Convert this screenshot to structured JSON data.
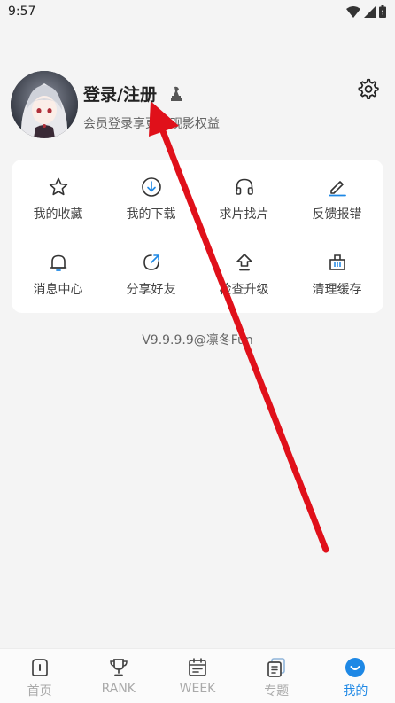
{
  "status": {
    "time": "9:57"
  },
  "profile": {
    "username": "登录/注册",
    "subtitle": "会员登录享更多观影权益"
  },
  "menu": [
    {
      "label": "我的收藏",
      "icon": "star-icon"
    },
    {
      "label": "我的下载",
      "icon": "download-icon"
    },
    {
      "label": "求片找片",
      "icon": "headphones-icon"
    },
    {
      "label": "反馈报错",
      "icon": "edit-icon"
    },
    {
      "label": "消息中心",
      "icon": "bell-icon"
    },
    {
      "label": "分享好友",
      "icon": "share-icon"
    },
    {
      "label": "检查升级",
      "icon": "upgrade-icon"
    },
    {
      "label": "清理缓存",
      "icon": "trash-icon"
    }
  ],
  "version": "V9.9.9.9@凛冬Fun",
  "tabs": [
    {
      "label": "首页",
      "icon": "home-icon"
    },
    {
      "label": "RANK",
      "icon": "trophy-icon"
    },
    {
      "label": "WEEK",
      "icon": "calendar-icon"
    },
    {
      "label": "专题",
      "icon": "topics-icon"
    },
    {
      "label": "我的",
      "icon": "profile-icon",
      "active": true
    }
  ],
  "colors": {
    "accent": "#1e88e5",
    "annotation": "#e0101a"
  }
}
